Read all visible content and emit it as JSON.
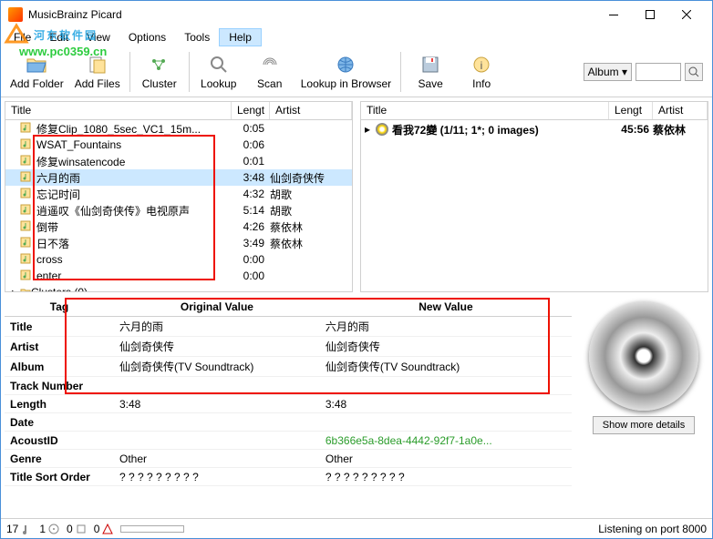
{
  "window": {
    "title": "MusicBrainz Picard"
  },
  "menu": {
    "file": "File",
    "edit": "Edit",
    "view": "View",
    "options": "Options",
    "tools": "Tools",
    "help": "Help"
  },
  "watermark": {
    "text": "河东软件园",
    "url": "www.pc0359.cn"
  },
  "toolbar": {
    "add_folder": "Add Folder",
    "add_files": "Add Files",
    "cluster": "Cluster",
    "lookup": "Lookup",
    "scan": "Scan",
    "lookup_browser": "Lookup in Browser",
    "save": "Save",
    "info": "Info",
    "select_value": "Album",
    "search_placeholder": ""
  },
  "left_header": {
    "title": "Title",
    "length": "Lengt",
    "artist": "Artist"
  },
  "left_rows": [
    {
      "title": "修复Clip_1080_5sec_VC1_15m...",
      "len": "0:05",
      "artist": "",
      "sel": false
    },
    {
      "title": "WSAT_Fountains",
      "len": "0:06",
      "artist": "",
      "sel": false
    },
    {
      "title": "修复winsatencode",
      "len": "0:01",
      "artist": "",
      "sel": false
    },
    {
      "title": "六月的雨",
      "len": "3:48",
      "artist": "仙剑奇侠传",
      "sel": true
    },
    {
      "title": "忘记时间",
      "len": "4:32",
      "artist": "胡歌",
      "sel": false
    },
    {
      "title": "逍遥叹《仙剑奇侠传》电视原声",
      "len": "5:14",
      "artist": "胡歌",
      "sel": false
    },
    {
      "title": "倒带",
      "len": "4:26",
      "artist": "蔡依林",
      "sel": false
    },
    {
      "title": "日不落",
      "len": "3:49",
      "artist": "蔡依林",
      "sel": false
    },
    {
      "title": "cross",
      "len": "0:00",
      "artist": "",
      "sel": false
    },
    {
      "title": "enter",
      "len": "0:00",
      "artist": "",
      "sel": false
    }
  ],
  "left_tree": {
    "clusters": "Clusters (0)"
  },
  "right_header": {
    "title": "Title",
    "length": "Lengt",
    "artist": "Artist"
  },
  "right_row": {
    "title": "看我72變 (1/11; 1*; 0 images)",
    "len": "45:56",
    "artist": "蔡依林"
  },
  "tags": {
    "head_tag": "Tag",
    "head_orig": "Original Value",
    "head_new": "New Value",
    "rows": [
      {
        "label": "Title",
        "orig": "六月的雨",
        "new": "六月的雨"
      },
      {
        "label": "Artist",
        "orig": "仙剑奇侠传",
        "new": "仙剑奇侠传"
      },
      {
        "label": "Album",
        "orig": "仙剑奇侠传(TV Soundtrack)",
        "new": "仙剑奇侠传(TV Soundtrack)"
      },
      {
        "label": "Track Number",
        "orig": "",
        "new": ""
      },
      {
        "label": "Length",
        "orig": "3:48",
        "new": "3:48"
      },
      {
        "label": "Date",
        "orig": "",
        "new": ""
      },
      {
        "label": "AcoustID",
        "orig": "",
        "new": "6b366e5a-8dea-4442-92f7-1a0e...",
        "new_green": true
      },
      {
        "label": "Genre",
        "orig": "Other",
        "new": "Other"
      },
      {
        "label": "Title Sort Order",
        "orig": "? ? ? ? ? ? ? ? ?",
        "new": "? ? ? ? ? ? ? ? ?"
      }
    ]
  },
  "detail": {
    "show_more": "Show more details"
  },
  "status": {
    "c1": "17",
    "c2": "1",
    "c3": "0",
    "c4": "0",
    "listen": "Listening on port 8000"
  }
}
